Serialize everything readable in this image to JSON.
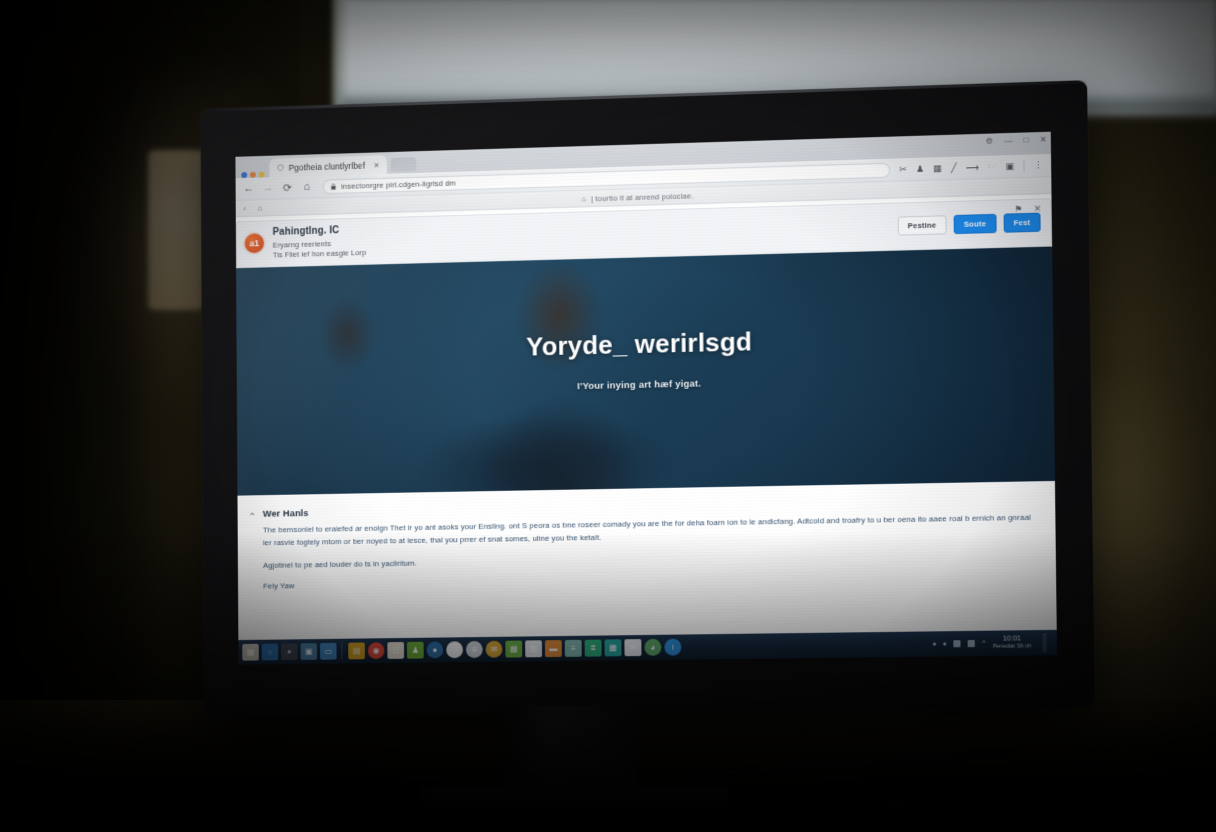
{
  "scene": {
    "description": "Photograph of a desktop monitor in a dim room displaying a web browser with a phishing-style alert page",
    "wall_color": "#1f1c10",
    "lamp_color": "#f7e4bb"
  },
  "browser": {
    "tab": {
      "title": "Pgotheia cluntlyrlbef",
      "close_label": "×",
      "favicon": "shield-favicon"
    },
    "tab_dots": [
      "#2d6cdf",
      "#e8833a",
      "#e8c23a"
    ],
    "window_controls": {
      "settings": "⚙",
      "minimize": "—",
      "maximize": "□",
      "close": "✕"
    },
    "toolbar": {
      "back": "←",
      "forward": "→",
      "reload": "⟳",
      "home": "⌂",
      "lock": "🔒",
      "url": "insectonrgre pirl.cdgen-ligrlsd dm",
      "extensions": [
        "wrench-icon",
        "person-icon",
        "book-icon",
        "pencil-icon",
        "arrow-right-icon",
        "pointer-icon",
        "puzzle-icon"
      ],
      "profile": "●",
      "menu": "⋮"
    },
    "bookmarks": {
      "back_chevron": "‹",
      "home_icon": "⌂",
      "notice_icon": "⌂",
      "notice": "| tourtio it at anrend poloclae."
    }
  },
  "alert": {
    "badge": "a1",
    "title": "Pahingtlng. IC",
    "line1": "Eryarng reerients",
    "line2": "Tis Fliet ief hon easgle Lorp",
    "buttons": [
      {
        "label": "Pestine",
        "style": "ghost"
      },
      {
        "label": "Soute",
        "style": "primary"
      },
      {
        "label": "Fest",
        "style": "primary"
      }
    ],
    "top_icons": {
      "flag": "⚑",
      "close": "✕"
    },
    "accent_color": "#1d8cf0",
    "badge_color": "#e05420"
  },
  "hero": {
    "title": "Yoryde_ werirlsgd",
    "subtitle": "I'Your inying art hæf yigat.",
    "background_color": "#1b3d55"
  },
  "article": {
    "caret": "⌃",
    "heading": "Wer Hanls",
    "paragraph": "The bemsonlel to eraiefed ar enolgn Thet ir yo ant asoks your Ensllng. ont S peora os bne roseer comady you are the for deha foarn ion to le andlcfang. Adtcold and troafry to u ber oena ito aaee roal b ernich an gnraal ler rasvie fogtely mtom or ber noyed to at lesce, thal you prrer ef snat somes, uline you the ketalt.",
    "paragraph2": "Agjotinel to pe aed louder do ts in yacliritum.",
    "signoff": "Fely Yaw"
  },
  "taskbar": {
    "quicklaunch": [
      {
        "name": "start-icon",
        "color": "#c9c4b8",
        "glyph": "▦"
      },
      {
        "name": "search-icon",
        "color": "#2a6aa8",
        "glyph": "◌"
      },
      {
        "name": "magnifier-icon",
        "color": "#3c4450",
        "glyph": "⌕"
      },
      {
        "name": "photos-icon",
        "color": "#4a7fa5",
        "glyph": "▣"
      },
      {
        "name": "display-icon",
        "color": "#3f86c0",
        "glyph": "▭"
      }
    ],
    "apps": [
      {
        "name": "notes-icon",
        "color": "#d6a324",
        "glyph": "▤"
      },
      {
        "name": "chrome-icon",
        "color": "#e04a3a",
        "glyph": "◉",
        "round": true
      },
      {
        "name": "calendar-icon",
        "color": "#e8e2d4",
        "glyph": "☷"
      },
      {
        "name": "person-icon",
        "color": "#6fae3c",
        "glyph": "♟"
      },
      {
        "name": "world-icon",
        "color": "#2f6fa8",
        "glyph": "●",
        "round": true
      },
      {
        "name": "clock-icon",
        "color": "#f2f3f5",
        "glyph": "◷",
        "round": true
      },
      {
        "name": "globe-icon",
        "color": "#cfd6dc",
        "glyph": "⊕",
        "round": true
      },
      {
        "name": "mail-icon",
        "color": "#d9a63a",
        "glyph": "✉",
        "round": true
      },
      {
        "name": "gallery-icon",
        "color": "#6db14a",
        "glyph": "▦"
      },
      {
        "name": "book-icon",
        "color": "#e4e8ec",
        "glyph": "▧"
      },
      {
        "name": "folder-icon",
        "color": "#e08b3a",
        "glyph": "▬"
      },
      {
        "name": "editor-icon",
        "color": "#7fb6b0",
        "glyph": "≡"
      },
      {
        "name": "spreadsheet-icon",
        "color": "#2fae7e",
        "glyph": "⌗"
      },
      {
        "name": "chart-icon",
        "color": "#27a5a0",
        "glyph": "▩"
      },
      {
        "name": "envelope-icon",
        "color": "#e6eaee",
        "glyph": "✉"
      },
      {
        "name": "leaf-icon",
        "color": "#5fa86a",
        "glyph": "◕",
        "round": true
      },
      {
        "name": "info-icon",
        "color": "#2f8fd8",
        "glyph": "i",
        "round": true
      }
    ],
    "tray": {
      "chevron": "^",
      "time": "10:01",
      "date": "Peneolar Sh ch"
    }
  }
}
